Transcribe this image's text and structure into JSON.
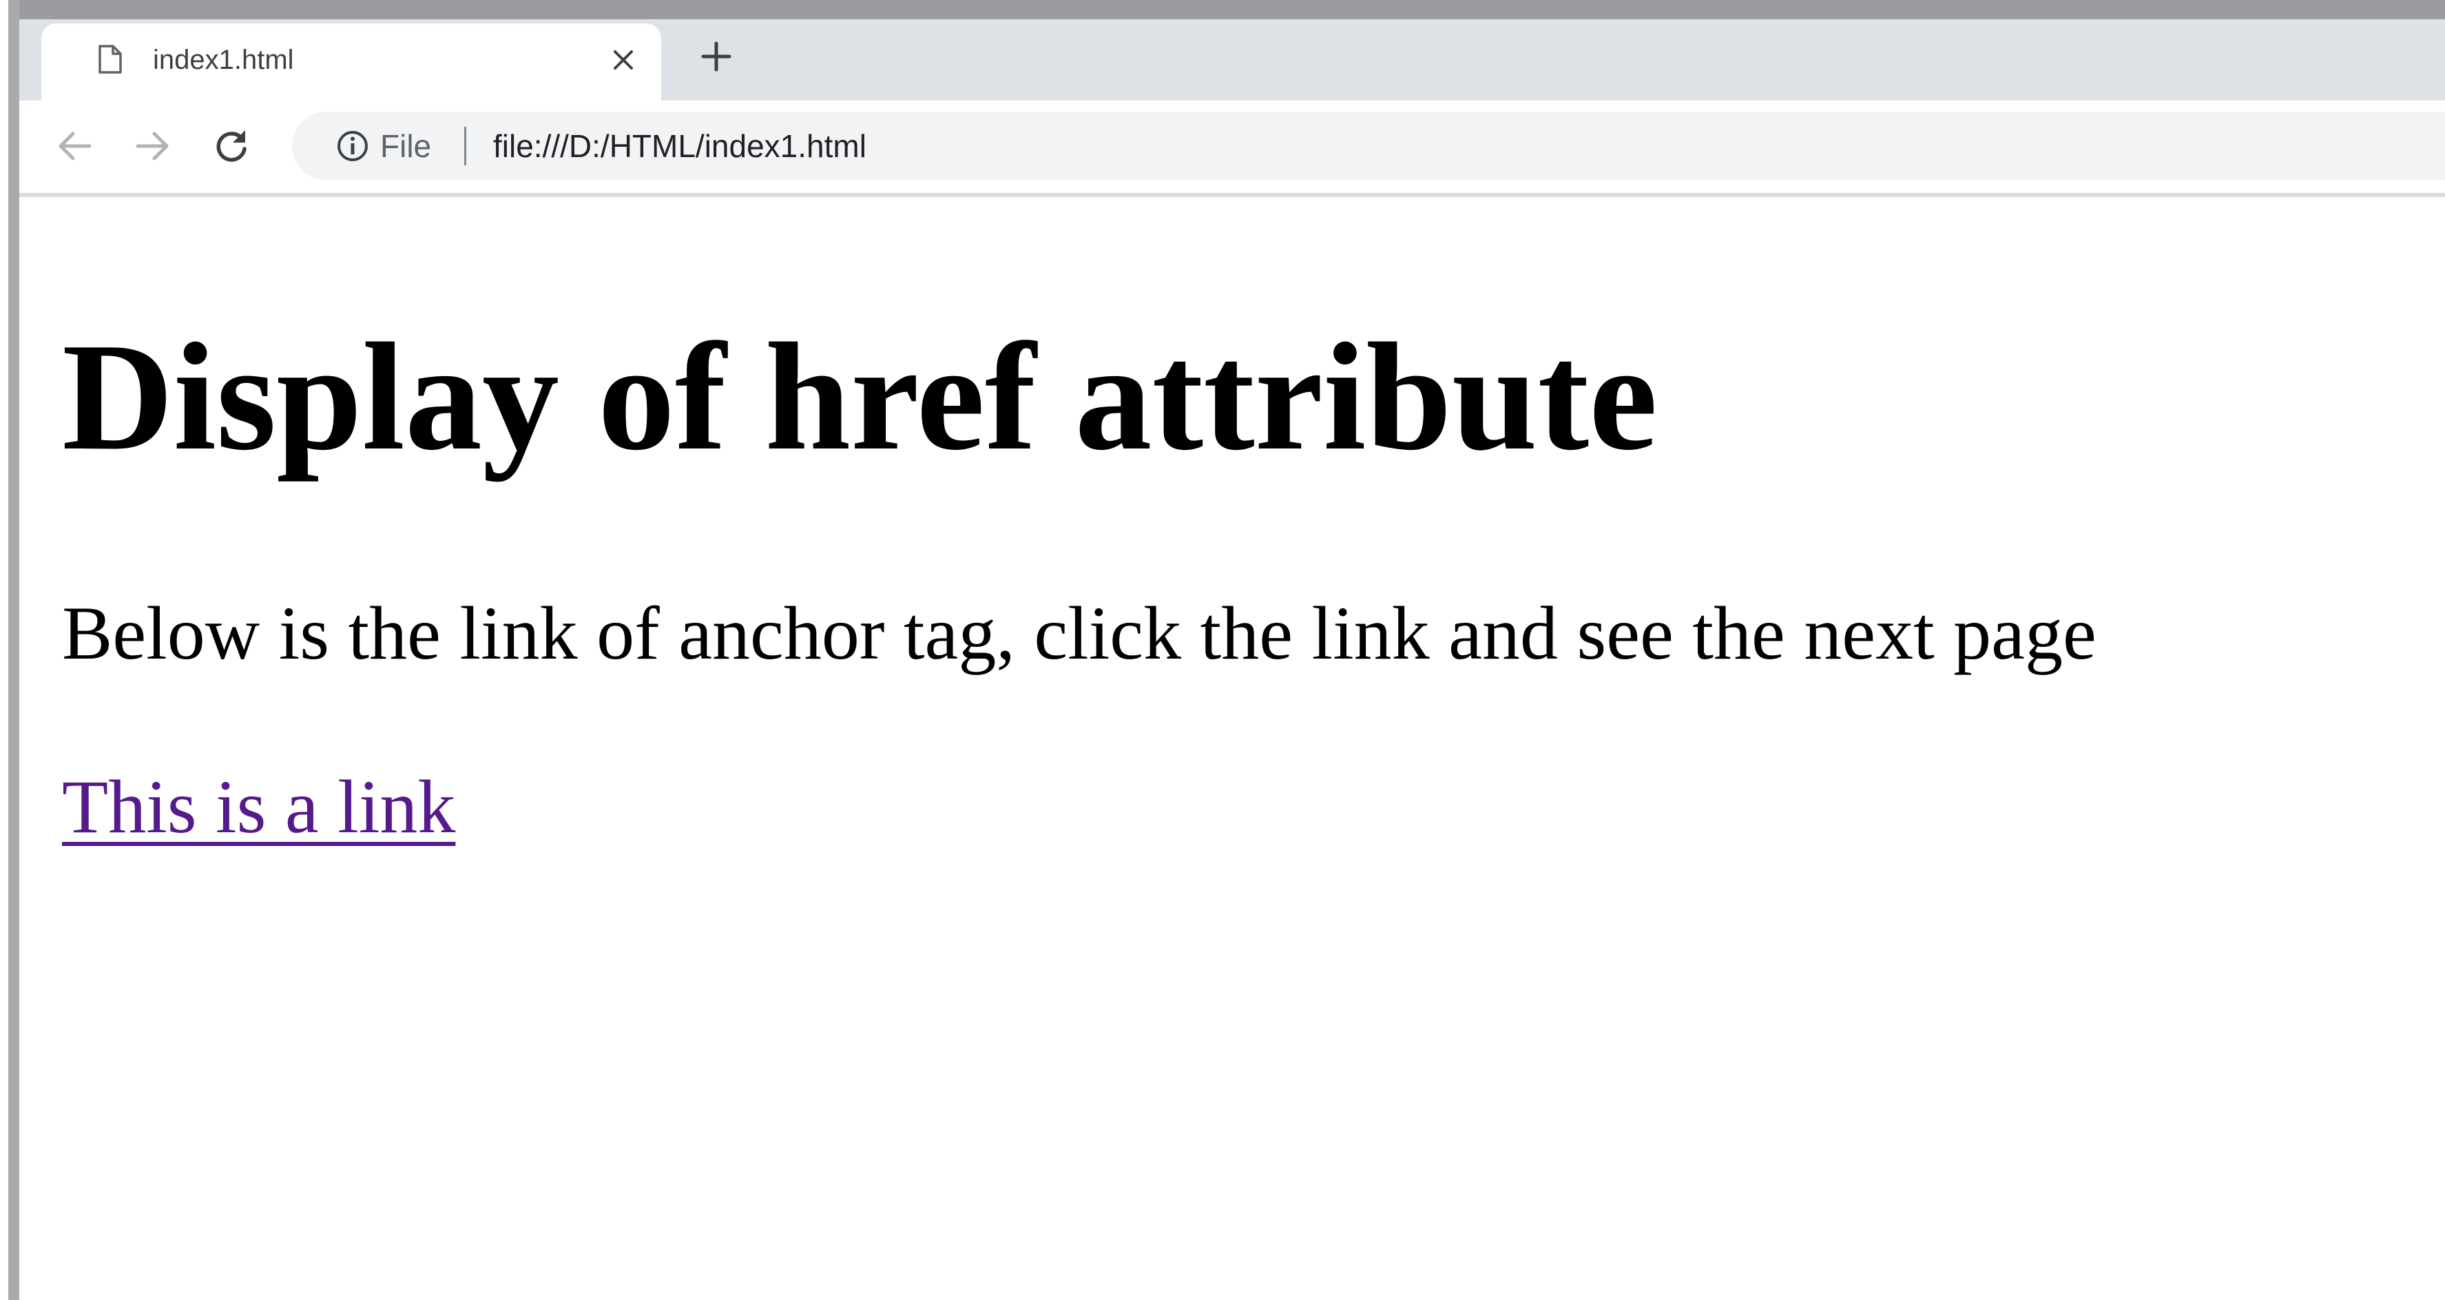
{
  "browser": {
    "tab": {
      "title": "index1.html",
      "page_icon": "page-icon",
      "close_icon": "close-icon"
    },
    "new_tab_icon": "plus-icon",
    "toolbar": {
      "back_icon": "back-arrow-icon",
      "forward_icon": "forward-arrow-icon",
      "reload_icon": "reload-icon"
    },
    "omnibox": {
      "info_icon": "info-icon",
      "scheme_label": "File",
      "url": "file:///D:/HTML/index1.html"
    }
  },
  "page": {
    "heading": "Display of href attribute",
    "paragraph": "Below is the link of anchor tag, click the link and see the next page",
    "link_text": "This is a link"
  },
  "colors": {
    "tabstrip_bg": "#dee1e6",
    "omnibox_bg": "#f1f3f4",
    "visited_link": "#551a8b"
  }
}
